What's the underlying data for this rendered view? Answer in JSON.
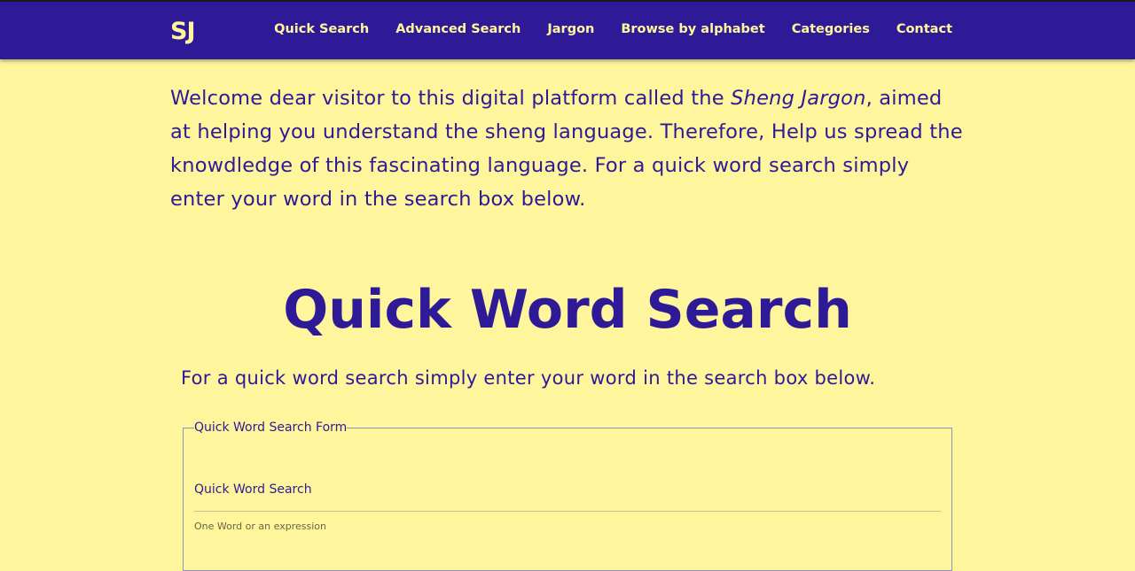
{
  "nav": {
    "logo": "SJ",
    "links": [
      "Quick Search",
      "Advanced Search",
      "Jargon",
      "Browse by alphabet",
      "Categories",
      "Contact"
    ]
  },
  "intro": {
    "before": "Welcome dear visitor to this digital platform called the ",
    "emphasis": "Sheng Jargon",
    "after": ", aimed at helping you understand the sheng language. Therefore, Help us spread the knowdledge of this fascinating language. For a quick word search simply enter your word in the search box below."
  },
  "main": {
    "title": "Quick Word Search",
    "subtitle": "For a quick word search simply enter your word in the search box below."
  },
  "form": {
    "legend": "Quick Word Search Form",
    "label": "Quick Word Search",
    "value": "",
    "helper": "One Word or an expression"
  },
  "colors": {
    "primary": "#2e1a96",
    "background": "#fff59d"
  }
}
